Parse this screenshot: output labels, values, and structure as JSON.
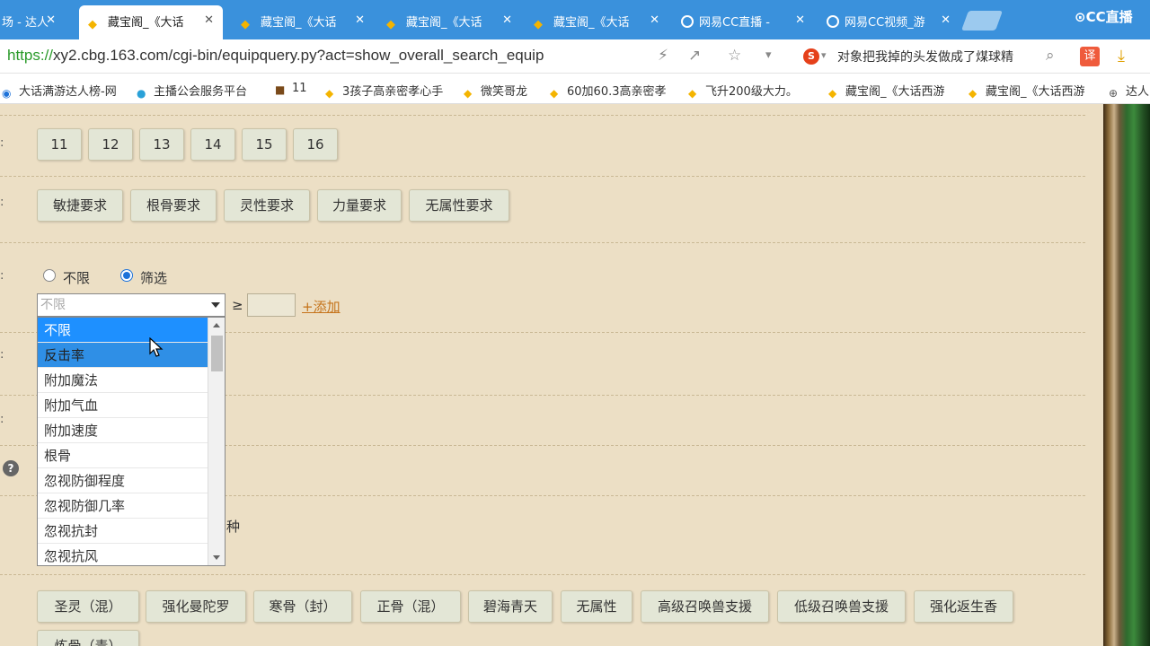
{
  "browser": {
    "tabs": [
      {
        "label": "场 - 达人",
        "active": false,
        "icon": "game-icon"
      },
      {
        "label": "藏宝阁_《大话",
        "active": true,
        "icon": "cbg-icon"
      },
      {
        "label": "藏宝阁_《大话",
        "active": false,
        "icon": "cbg-icon"
      },
      {
        "label": "藏宝阁_《大话",
        "active": false,
        "icon": "cbg-icon"
      },
      {
        "label": "藏宝阁_《大话",
        "active": false,
        "icon": "cbg-icon"
      },
      {
        "label": "网易CC直播 -",
        "active": false,
        "icon": "cc-icon"
      },
      {
        "label": "网易CC视频_游",
        "active": false,
        "icon": "cc-icon"
      }
    ],
    "tab_close": "✕",
    "brand": "CC直播",
    "url_proto": "https://",
    "url_rest": "xy2.cbg.163.com/cgi-bin/equipquery.py?act=show_overall_search_equip",
    "search_text": "对象把我掉的头发做成了煤球精",
    "translate_label": "译",
    "bookmarks": [
      "大话满游达人榜-网",
      "主播公会服务平台",
      "11",
      "3孩子高亲密孝心手",
      "微笑哥龙",
      "60加60.3高亲密孝",
      "飞升200级大力。",
      "藏宝阁_《大话西游",
      "藏宝阁_《大话西游",
      "达人"
    ]
  },
  "level_buttons": [
    "11",
    "12",
    "13",
    "14",
    "15",
    "16"
  ],
  "requirement_buttons": [
    "敏捷要求",
    "根骨要求",
    "灵性要求",
    "力量要求",
    "无属性要求"
  ],
  "filter": {
    "radio_unlimited": "不限",
    "radio_filter": "筛选",
    "select_value": "不限",
    "gte_symbol": "≥",
    "add_link": "+添加",
    "options": [
      "不限",
      "反击率",
      "附加魔法",
      "附加气血",
      "附加速度",
      "根骨",
      "忽视防御程度",
      "忽视防御几率",
      "忽视抗封",
      "忽视抗风"
    ]
  },
  "partial_label": "种",
  "help_label": "?",
  "skill_buttons": [
    "圣灵（混）",
    "强化曼陀罗",
    "寒骨（封）",
    "正骨（混）",
    "碧海青天",
    "无属性",
    "高级召唤兽支援",
    "低级召唤兽支援",
    "强化返生香",
    "炼骨（毒）"
  ],
  "colon": ":"
}
